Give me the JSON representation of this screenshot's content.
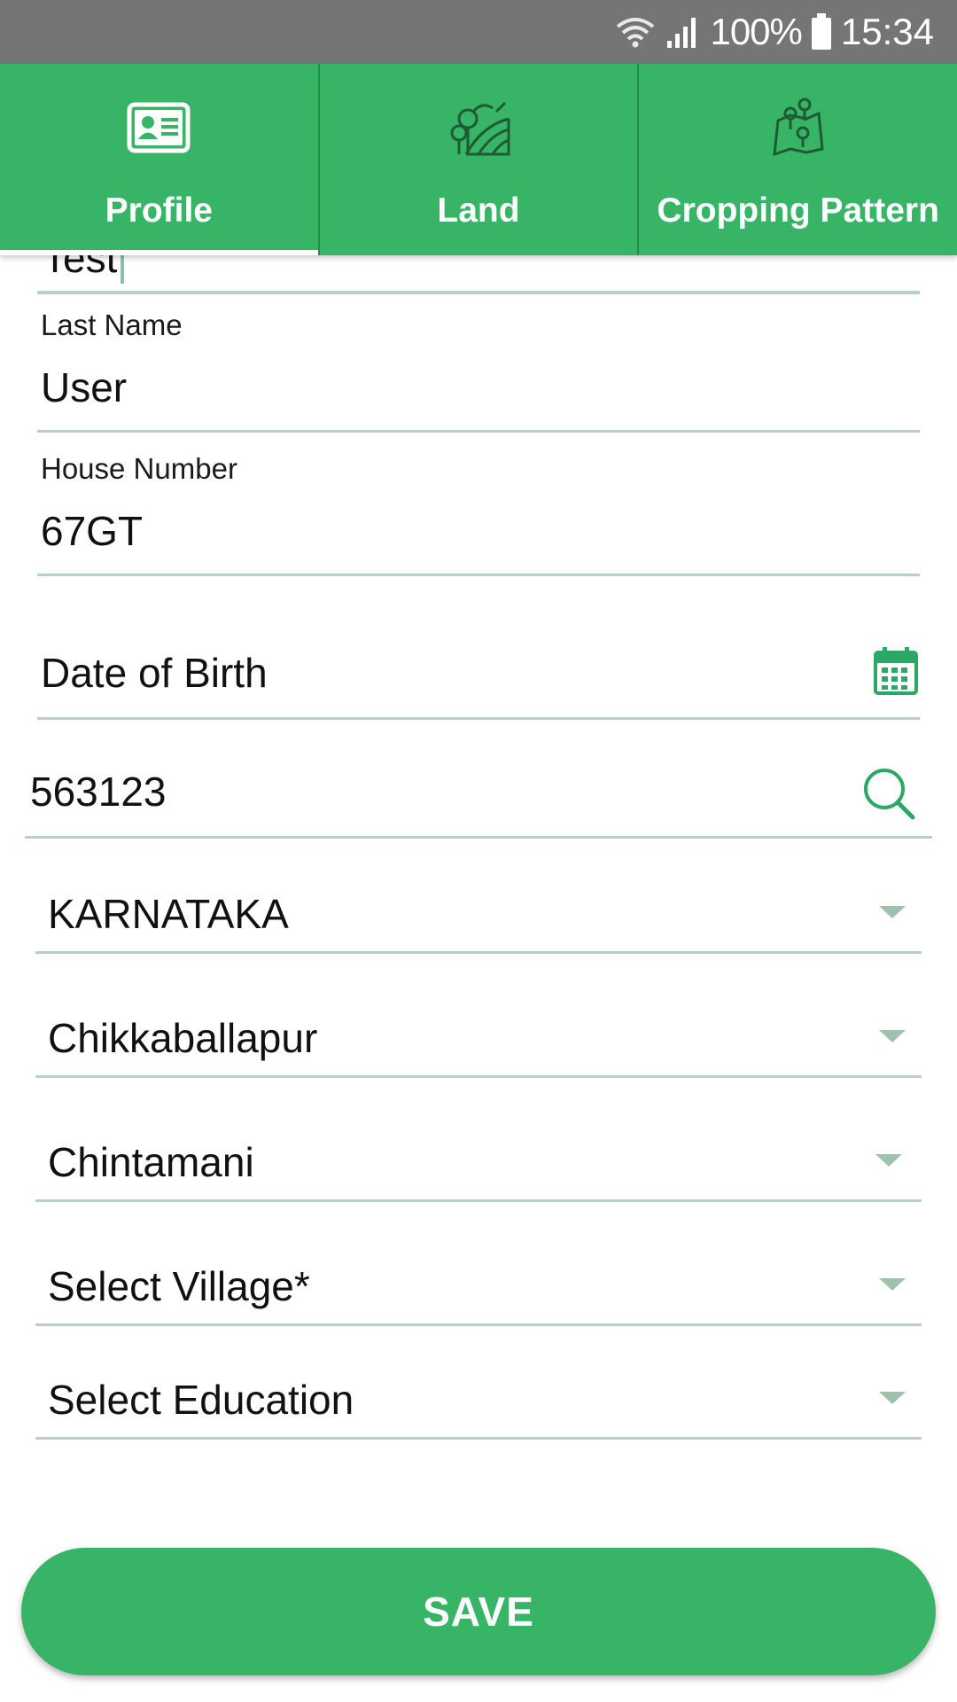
{
  "status_bar": {
    "battery_percent": "100%",
    "time": "15:34",
    "icons": [
      "wifi-icon",
      "signal-icon",
      "battery-icon"
    ]
  },
  "tabs": [
    {
      "label": "Profile",
      "icon": "id-card-icon",
      "active": true
    },
    {
      "label": "Land",
      "icon": "land-field-icon",
      "active": false
    },
    {
      "label": "Cropping Pattern",
      "icon": "map-pin-icon",
      "active": false
    }
  ],
  "form": {
    "first_name": {
      "value": "Test"
    },
    "last_name": {
      "label": "Last Name",
      "value": "User"
    },
    "house_number": {
      "label": "House Number",
      "value": "67GT"
    },
    "date_of_birth": {
      "placeholder": "Date of Birth",
      "icon": "calendar-icon"
    },
    "pincode": {
      "value": "563123",
      "icon": "search-icon"
    },
    "state": {
      "selected": "KARNATAKA"
    },
    "district": {
      "selected": "Chikkaballapur"
    },
    "taluk": {
      "selected": "Chintamani"
    },
    "village": {
      "selected": "Select Village*"
    },
    "education": {
      "selected": "Select Education"
    }
  },
  "save_button": {
    "label": "SAVE"
  },
  "colors": {
    "primary_green": "#38b466",
    "status_bar_gray": "#757575",
    "underline": "#b7d1c3",
    "icon_green": "#2aa865"
  }
}
